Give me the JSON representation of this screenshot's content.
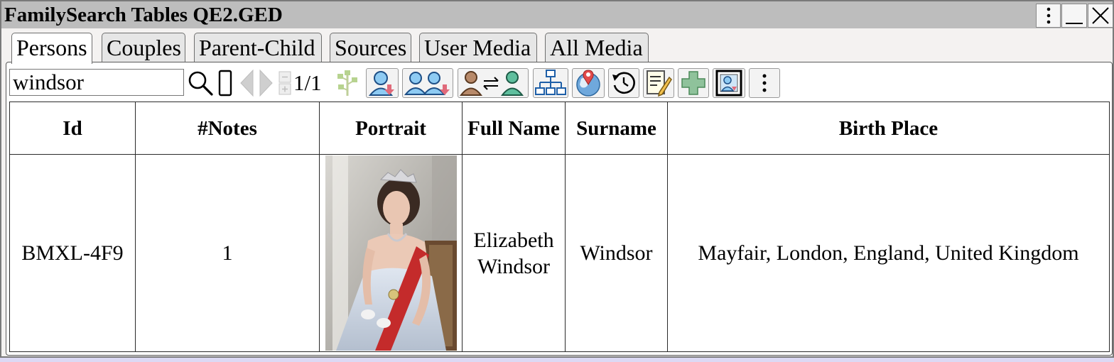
{
  "window": {
    "title": "FamilySearch Tables QE2.GED",
    "menu_icon": "vertical-dots-icon",
    "minimize_icon": "minimize-icon",
    "close_icon": "close-icon"
  },
  "tabs": [
    {
      "label": "Persons",
      "active": true
    },
    {
      "label": "Couples",
      "active": false
    },
    {
      "label": "Parent-Child",
      "active": false
    },
    {
      "label": "Sources",
      "active": false
    },
    {
      "label": "User Media",
      "active": false
    },
    {
      "label": "All Media",
      "active": false
    }
  ],
  "toolbar": {
    "search_value": "windsor",
    "page_info": "1/1",
    "icons": [
      "search-icon",
      "stop-icon",
      "prev-page-icon",
      "next-page-icon",
      "page-stepper-icon",
      "family-tree-icon",
      "download-person-icon",
      "download-couple-icon",
      "merge-persons-icon",
      "pedigree-chart-icon",
      "map-location-icon",
      "history-icon",
      "edit-notes-icon",
      "add-icon",
      "portrait-frame-icon",
      "more-options-icon"
    ]
  },
  "table": {
    "headers": [
      "Id",
      "#Notes",
      "Portrait",
      "Full Name",
      "Surname",
      "Birth Place"
    ],
    "rows": [
      {
        "id": "BMXL-4F9",
        "notes": "1",
        "full_name": "Elizabeth Windsor",
        "surname": "Windsor",
        "birth_place": "Mayfair, London, England, United Kingdom"
      }
    ]
  },
  "colors": {
    "titlebar": "#bdbdbd",
    "window_bg": "#f4f2f1",
    "desktop": "#dcd9f4",
    "icon_blue": "#8ecbf3",
    "icon_green": "#5fbf9e",
    "icon_tan": "#b88a6a"
  }
}
